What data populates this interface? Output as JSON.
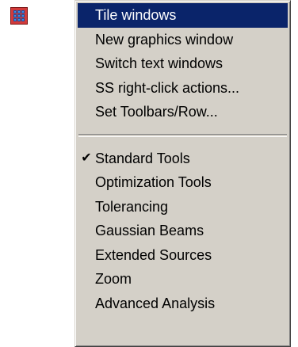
{
  "app_icon": {
    "name": "tile-windows-icon"
  },
  "menu": {
    "group1": [
      {
        "label": "Tile windows",
        "selected": true
      },
      {
        "label": "New graphics window"
      },
      {
        "label": "Switch text windows"
      },
      {
        "label": "SS right-click actions..."
      },
      {
        "label": "Set Toolbars/Row..."
      }
    ],
    "group2": [
      {
        "label": "Standard Tools",
        "checked": true,
        "check_glyph": "✔"
      },
      {
        "label": "Optimization Tools"
      },
      {
        "label": "Tolerancing"
      },
      {
        "label": "Gaussian Beams"
      },
      {
        "label": "Extended Sources"
      },
      {
        "label": "Zoom"
      },
      {
        "label": "Advanced Analysis"
      }
    ]
  },
  "colors": {
    "menu_bg": "#d4d0c8",
    "highlight_bg": "#0a246a",
    "highlight_fg": "#ffffff",
    "icon_red": "#d23a3a",
    "icon_blue": "#3a8de8"
  }
}
